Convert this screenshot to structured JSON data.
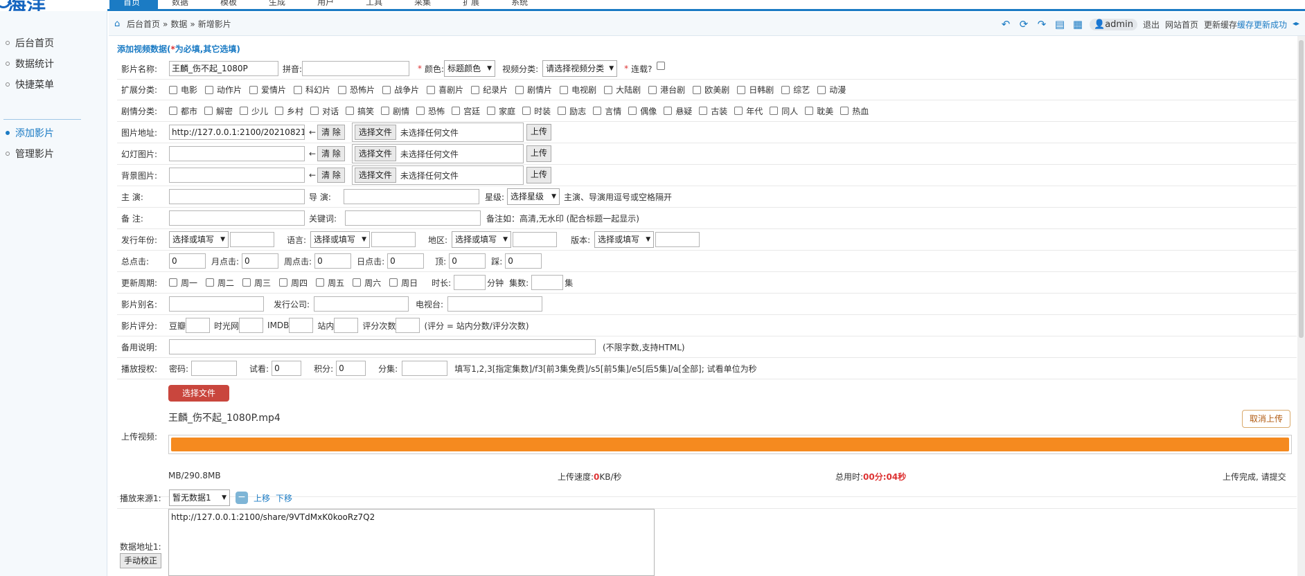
{
  "app": {
    "logo_text": "海洋"
  },
  "topnav": [
    "首页",
    "数据",
    "模板",
    "生成",
    "用户",
    "工具",
    "采集",
    "扩展",
    "系统"
  ],
  "sidebar": {
    "items": [
      {
        "label": "后台首页",
        "active": false
      },
      {
        "label": "数据统计",
        "active": false
      },
      {
        "label": "快捷菜单",
        "active": false
      },
      {
        "label": "添加影片",
        "active": true
      },
      {
        "label": "管理影片",
        "active": false
      }
    ]
  },
  "breadcrumb": {
    "home": "后台首页",
    "sep": "»",
    "level2": "数据",
    "level3": "新增影片"
  },
  "toolbar": {
    "icons": [
      "back-icon",
      "refresh-icon",
      "forward-icon",
      "calculator-icon",
      "layout-icon"
    ],
    "user": "admin",
    "logout": "退出",
    "site_home": "网站首页",
    "cache_update": "更新缓存",
    "cache_status": "缓存更新成功"
  },
  "form": {
    "title_prefix": "添加视频数据(",
    "title_req": "*",
    "title_suffix": "为必填,其它选填)",
    "name": {
      "label": "影片名称:",
      "value": "王麟_伤不起_1080P"
    },
    "pinyin": {
      "label": "拼音:",
      "value": ""
    },
    "color": {
      "label": "颜色:",
      "value": "标题颜色"
    },
    "category": {
      "label": "视频分类:",
      "value": "请选择视频分类"
    },
    "serial": {
      "label": "连载?"
    },
    "ext_cat": {
      "label": "扩展分类:",
      "items": [
        "电影",
        "动作片",
        "爱情片",
        "科幻片",
        "恐怖片",
        "战争片",
        "喜剧片",
        "纪录片",
        "剧情片",
        "电视剧",
        "大陆剧",
        "港台剧",
        "欧美剧",
        "日韩剧",
        "综艺",
        "动漫"
      ]
    },
    "plot_cat": {
      "label": "剧情分类:",
      "items": [
        "都市",
        "解密",
        "少儿",
        "乡村",
        "对话",
        "搞笑",
        "剧情",
        "恐怖",
        "宫廷",
        "家庭",
        "时装",
        "励志",
        "言情",
        "偶像",
        "悬疑",
        "古装",
        "年代",
        "同人",
        "耽美",
        "热血"
      ]
    },
    "pic": {
      "label": "图片地址:",
      "value": "http://127.0.0.1:2100/20210821/2"
    },
    "slide": {
      "label": "幻灯图片:",
      "value": ""
    },
    "bg": {
      "label": "背景图片:",
      "value": ""
    },
    "arrow": "←",
    "clear_btn": "清 除",
    "choose_file": "选择文件",
    "no_file": "未选择任何文件",
    "upload_btn": "上传",
    "actor": {
      "label": "主 演:",
      "value": ""
    },
    "director": {
      "label": "导 演:",
      "value": ""
    },
    "star": {
      "label": "星级:",
      "value": "选择星级"
    },
    "actor_tip": "主演、导演用逗号或空格隔开",
    "remark": {
      "label": "备 注:",
      "value": ""
    },
    "keywords": {
      "label": "关键词:",
      "value": ""
    },
    "remark_tip": "备注如：高清,无水印 (配合标题一起显示)",
    "year": {
      "label": "发行年份:",
      "value": "选择或填写"
    },
    "lang": {
      "label": "语言:",
      "value": "选择或填写"
    },
    "area": {
      "label": "地区:",
      "value": "选择或填写"
    },
    "version": {
      "label": "版本:",
      "value": "选择或填写"
    },
    "hits": {
      "label": "总点击:",
      "value": "0"
    },
    "hits_month": {
      "label": "月点击:",
      "value": "0"
    },
    "hits_week": {
      "label": "周点击:",
      "value": "0"
    },
    "hits_day": {
      "label": "日点击:",
      "value": "0"
    },
    "up": {
      "label": "顶:",
      "value": "0"
    },
    "down": {
      "label": "踩:",
      "value": "0"
    },
    "weekday": {
      "label": "更新周期:",
      "items": [
        "周一",
        "周二",
        "周三",
        "周四",
        "周五",
        "周六",
        "周日"
      ]
    },
    "duration": {
      "label": "时长:",
      "unit": "分钟"
    },
    "episodes": {
      "label": "集数:",
      "unit": "集"
    },
    "alias": {
      "label": "影片别名:",
      "value": ""
    },
    "company": {
      "label": "发行公司:",
      "value": ""
    },
    "tv": {
      "label": "电视台:",
      "value": ""
    },
    "score": {
      "label": "影片评分:",
      "douban": "豆瓣",
      "mtime": "时光网",
      "imdb": "IMDB",
      "site": "站内",
      "count": "评分次数",
      "tip": "(评分 = 站内分数/评分次数)"
    },
    "notes": {
      "label": "备用说明:",
      "tip": "(不限字数,支持HTML)"
    },
    "auth": {
      "label": "播放授权:",
      "pwd": "密码:",
      "trial": "试看:",
      "trial_value": "0",
      "points": "积分:",
      "points_value": "0",
      "split": "分集:",
      "tip": "填写1,2,3[指定集数]/f3[前3集免费]/s5[前5集]/e5[后5集]/a[全部]; 试看单位为秒"
    },
    "upload": {
      "label": "上传视频:",
      "choose_btn": "选择文件",
      "filename": "王麟_伤不起_1080P.mp4",
      "cancel_btn": "取消上传",
      "progress": 1.0,
      "size": "MB/290.8MB",
      "speed_label": "上传速度:",
      "speed_value": "0",
      "speed_unit": "KB/秒",
      "time_label": "总用时:",
      "time_value": "00分:04秒",
      "status": "上传完成, 请提交"
    },
    "source": {
      "label": "播放来源1:",
      "value": "暂无数据1",
      "minus": "−",
      "up": "上移",
      "down": "下移"
    },
    "data_url": {
      "label": "数据地址1:",
      "calib_btn": "手动校正",
      "value": "http://127.0.0.1:2100/share/9VTdMxK0kooRz7Q2"
    }
  },
  "colors": {
    "accent": "#1b7bc4",
    "progress": "#f58a1f",
    "danger_btn": "#c9463d",
    "required": "#dd3333"
  }
}
